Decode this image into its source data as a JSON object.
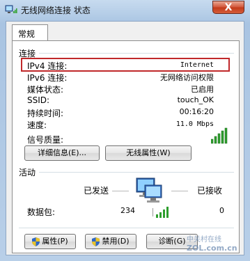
{
  "window": {
    "title": "无线网络连接 状态",
    "close_glyph": "X"
  },
  "tabs": [
    {
      "label": "常规"
    }
  ],
  "connection": {
    "section_label": "连接",
    "rows": [
      {
        "label": "IPv4 连接:",
        "value": "Internet"
      },
      {
        "label": "IPv6 连接:",
        "value": "无网络访问权限"
      },
      {
        "label": "媒体状态:",
        "value": "已启用"
      },
      {
        "label": "SSID:",
        "value": "touch_OK"
      },
      {
        "label": "持续时间:",
        "value": "00:16:20"
      },
      {
        "label": "速度:",
        "value": "11.0 Mbps"
      }
    ],
    "signal_label": "信号质量:",
    "signal_icon": "signal-bars-icon",
    "signal_level_bars": 5
  },
  "buttons": {
    "details": "详细信息(E)...",
    "wireless_properties": "无线属性(W)",
    "properties": "属性(P)",
    "disable": "禁用(D)",
    "diagnose": "诊断(G)"
  },
  "activity": {
    "section_label": "活动",
    "sent_label": "已发送",
    "received_label": "已接收",
    "packets_label": "数据包:",
    "packets_sent": "234",
    "packets_received": "0",
    "icon": "network-computers-icon"
  },
  "watermark": {
    "line1": "中关村在线",
    "line2": "ZOL.com.cn"
  },
  "colors": {
    "highlight_box": "#c0282a",
    "close_button": "#c23a1a",
    "signal_green": "#2e9e2e"
  }
}
